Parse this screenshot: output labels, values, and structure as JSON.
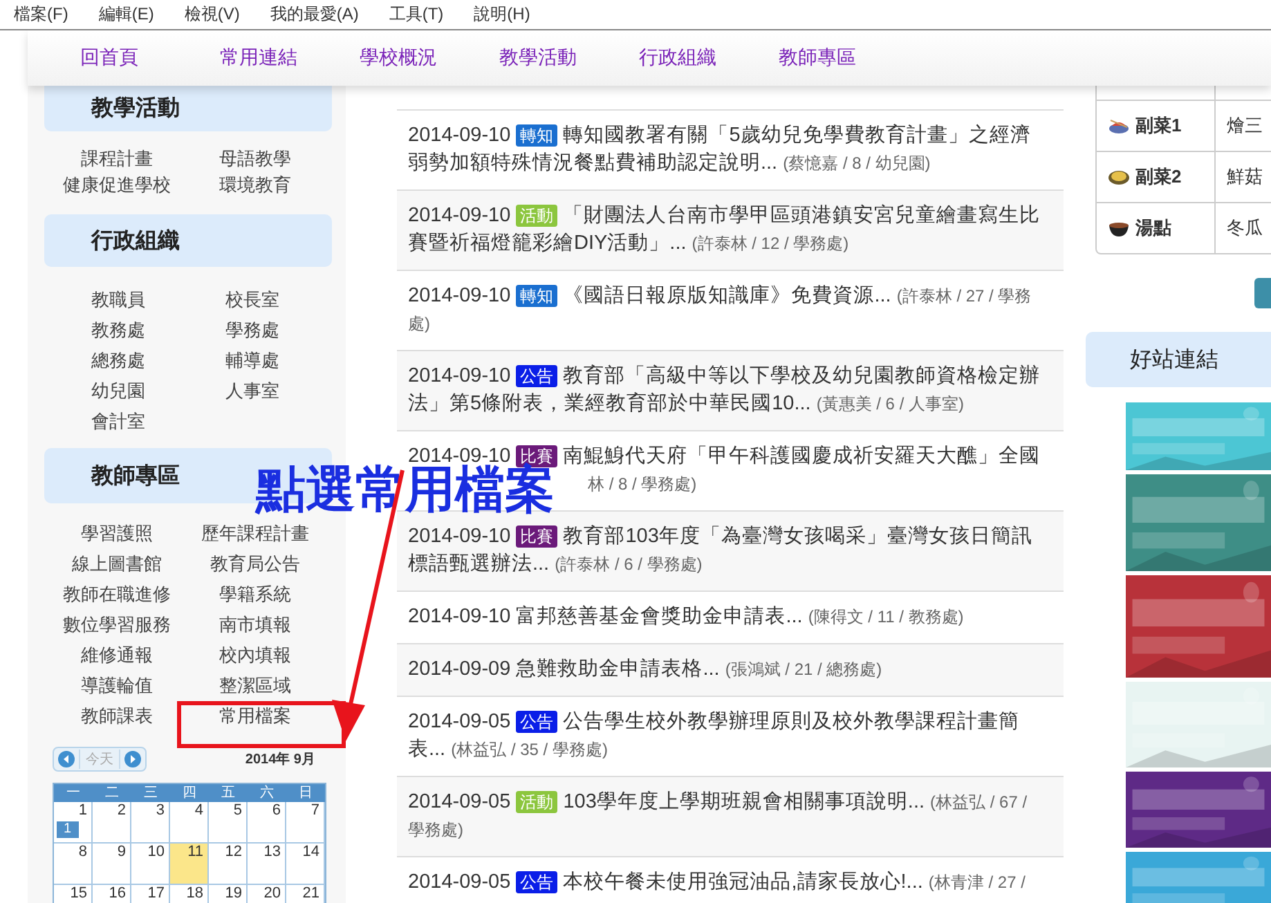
{
  "menu_bar": [
    "檔案(F)",
    "編輯(E)",
    "檢視(V)",
    "我的最愛(A)",
    "工具(T)",
    "說明(H)"
  ],
  "nav": [
    "回首頁",
    "常用連結",
    "學校概況",
    "教學活動",
    "行政組織",
    "教師專區"
  ],
  "sidebar": {
    "sections": [
      {
        "title": "教學活動",
        "links": [
          "課程計畫",
          "母語教學",
          "健康促進學校",
          "環境教育"
        ]
      },
      {
        "title": "行政組織",
        "links": [
          "教職員",
          "校長室",
          "教務處",
          "學務處",
          "總務處",
          "輔導處",
          "幼兒園",
          "人事室",
          "會計室"
        ]
      },
      {
        "title": "教師專區",
        "links": [
          "學習護照",
          "歷年課程計畫",
          "線上圖書館",
          "教育局公告",
          "教師在職進修",
          "學籍系統",
          "數位學習服務",
          "南市填報",
          "維修通報",
          "校內填報",
          "導護輪值",
          "整潔區域",
          "教師課表",
          "常用檔案"
        ]
      }
    ]
  },
  "calendar": {
    "today_button": "今天",
    "month": "2014年 9月",
    "weekdays": [
      "一",
      "二",
      "三",
      "四",
      "五",
      "六",
      "日"
    ],
    "weeks": [
      [
        {
          "day": "1",
          "today": false,
          "badge": "1"
        },
        {
          "day": "2",
          "today": false
        },
        {
          "day": "3",
          "today": false
        },
        {
          "day": "4",
          "today": false
        },
        {
          "day": "5",
          "today": false
        },
        {
          "day": "6",
          "today": false
        },
        {
          "day": "7",
          "today": false
        }
      ],
      [
        {
          "day": "8",
          "today": false
        },
        {
          "day": "9",
          "today": false
        },
        {
          "day": "10",
          "today": false
        },
        {
          "day": "11",
          "today": true
        },
        {
          "day": "12",
          "today": false
        },
        {
          "day": "13",
          "today": false
        },
        {
          "day": "14",
          "today": false
        }
      ],
      [
        {
          "day": "15",
          "today": false
        },
        {
          "day": "16",
          "today": false
        },
        {
          "day": "17",
          "today": false
        },
        {
          "day": "18",
          "today": false
        },
        {
          "day": "19",
          "today": false
        },
        {
          "day": "20",
          "today": false
        },
        {
          "day": "21",
          "today": false
        }
      ]
    ]
  },
  "news": [
    {
      "date": "2014-09-10",
      "tag": {
        "label": "轉知",
        "color": "#1a6fd0"
      },
      "title": "轉知國教署有關「5歲幼兒免學費教育計畫」之經濟弱勢加額特殊情況餐點費補助認定說明...",
      "meta": "(蔡憶嘉 / 8 / 幼兒園)"
    },
    {
      "date": "2014-09-10",
      "tag": {
        "label": "活動",
        "color": "#8cc63e"
      },
      "title": "「財團法人台南市學甲區頭港鎮安宮兒童繪畫寫生比賽暨祈福燈籠彩繪DIY活動」...",
      "meta": "(許泰林 / 12 / 學務處)"
    },
    {
      "date": "2014-09-10",
      "tag": {
        "label": "轉知",
        "color": "#1a6fd0"
      },
      "title": "《國語日報原版知識庫》免費資源...",
      "meta": "(許泰林 / 27 / 學務處)"
    },
    {
      "date": "2014-09-10",
      "tag": {
        "label": "公告",
        "color": "#0a1ee8"
      },
      "title": "教育部「高級中等以下學校及幼兒園教師資格檢定辦法」第5條附表，業經教育部於中華民國10...",
      "meta": "(黃惠美 / 6 / 人事室)"
    },
    {
      "date": "2014-09-10",
      "tag": {
        "label": "比賽",
        "color": "#6b1a7a"
      },
      "title": "南鯤鯓代天府「甲午科護國慶成祈安羅天大醮」全國",
      "meta": "林 / 8 / 學務處)",
      "meta_covered": true
    },
    {
      "date": "2014-09-10",
      "tag": {
        "label": "比賽",
        "color": "#6b1a7a"
      },
      "title": "教育部103年度「為臺灣女孩喝采」臺灣女孩日簡訊標語甄選辦法...",
      "meta": "(許泰林 / 6 / 學務處)"
    },
    {
      "date": "2014-09-10",
      "title": "富邦慈善基金會獎助金申請表...",
      "meta": "(陳得文 / 11 / 教務處)"
    },
    {
      "date": "2014-09-09",
      "title": "急難救助金申請表格...",
      "meta": "(張鴻斌 / 21 / 總務處)"
    },
    {
      "date": "2014-09-05",
      "tag": {
        "label": "公告",
        "color": "#0a1ee8"
      },
      "title": "公告學生校外教學辦理原則及校外教學課程計畫簡表...",
      "meta": "(林益弘 / 35 / 學務處)"
    },
    {
      "date": "2014-09-05",
      "tag": {
        "label": "活動",
        "color": "#8cc63e"
      },
      "title": "103學年度上學期班親會相關事項說明...",
      "meta": "(林益弘 / 67 / 學務處)"
    },
    {
      "date": "2014-09-05",
      "tag": {
        "label": "公告",
        "color": "#0a1ee8"
      },
      "title": "本校午餐未使用強冠油品,請家長放心!...",
      "meta": "(林青津 / 27 /"
    }
  ],
  "lunch": [
    {
      "kind": "plate",
      "dish": "副菜1",
      "menu": "燴三"
    },
    {
      "kind": "tofu",
      "dish": "副菜2",
      "menu": "鮮菇"
    },
    {
      "kind": "soup",
      "dish": "湯點",
      "menu": "冬瓜"
    }
  ],
  "links_panel": {
    "title": "好站連結"
  },
  "annotation": {
    "text": "點選常用檔案"
  }
}
